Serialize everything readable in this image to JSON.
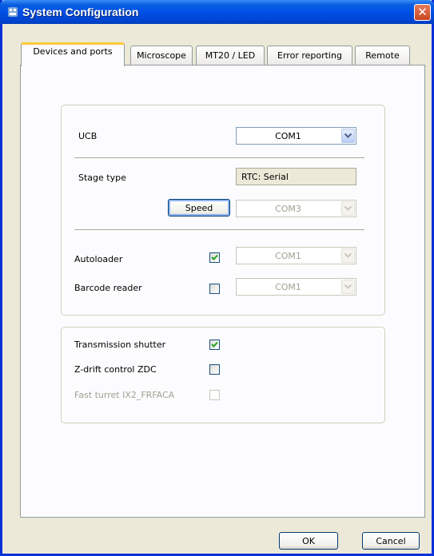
{
  "window": {
    "title": "System Configuration"
  },
  "tabs": [
    {
      "label": "Devices and ports",
      "active": true
    },
    {
      "label": "Microscope"
    },
    {
      "label": "MT20 / LED"
    },
    {
      "label": "Error reporting"
    },
    {
      "label": "Remote"
    }
  ],
  "devices": {
    "ucb": {
      "label": "UCB",
      "value": "COM1"
    },
    "stage": {
      "label": "Stage type",
      "value": "RTC: Serial"
    },
    "speed": {
      "button_label": "Speed",
      "port": "COM3"
    },
    "autoloader": {
      "label": "Autoloader",
      "checked": true,
      "port": "COM1"
    },
    "barcode": {
      "label": "Barcode reader",
      "checked": false,
      "port": "COM1"
    }
  },
  "options": {
    "transmission_shutter": {
      "label": "Transmission shutter",
      "checked": true
    },
    "zdc": {
      "label": "Z-drift control ZDC",
      "checked": false
    },
    "fast_turret": {
      "label": "Fast turret IX2_FRFACA",
      "checked": false,
      "enabled": false
    }
  },
  "buttons": {
    "ok": "OK",
    "cancel": "Cancel"
  },
  "colors": {
    "title_bar": "#0050e6",
    "check": "#21a121",
    "active_tab_accent": "#ffc83c"
  }
}
